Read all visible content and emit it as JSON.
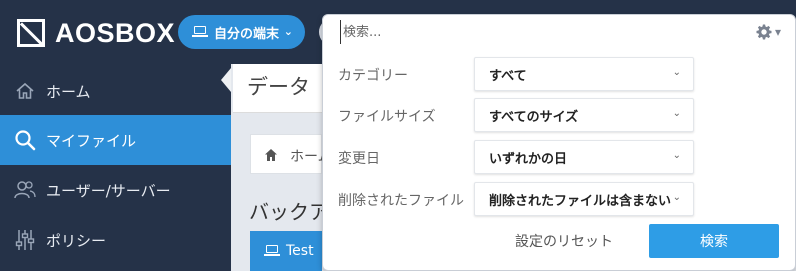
{
  "header": {
    "logo_text": "AOSBOX",
    "device_selector": "自分の端末"
  },
  "sidebar": {
    "items": [
      {
        "label": "ホーム",
        "icon": "home-icon"
      },
      {
        "label": "マイファイル",
        "icon": "search-icon",
        "active": true
      },
      {
        "label": "ユーザー/サーバー",
        "icon": "users-icon"
      },
      {
        "label": "ポリシー",
        "icon": "sliders-icon"
      }
    ]
  },
  "main": {
    "title": "データ",
    "breadcrumb": "ホーム",
    "section_title": "バックアップ",
    "device_row": "Test"
  },
  "search_panel": {
    "placeholder": "検索...",
    "filters": [
      {
        "label": "カテゴリー",
        "value": "すべて"
      },
      {
        "label": "ファイルサイズ",
        "value": "すべてのサイズ"
      },
      {
        "label": "変更日",
        "value": "いずれかの日"
      },
      {
        "label": "削除されたファイル",
        "value": "削除されたファイルは含まない"
      }
    ],
    "reset_label": "設定のリセット",
    "search_label": "検索"
  },
  "colors": {
    "sidebar_bg": "#253248",
    "accent": "#2e8fd8",
    "search_button": "#2e9de6"
  }
}
